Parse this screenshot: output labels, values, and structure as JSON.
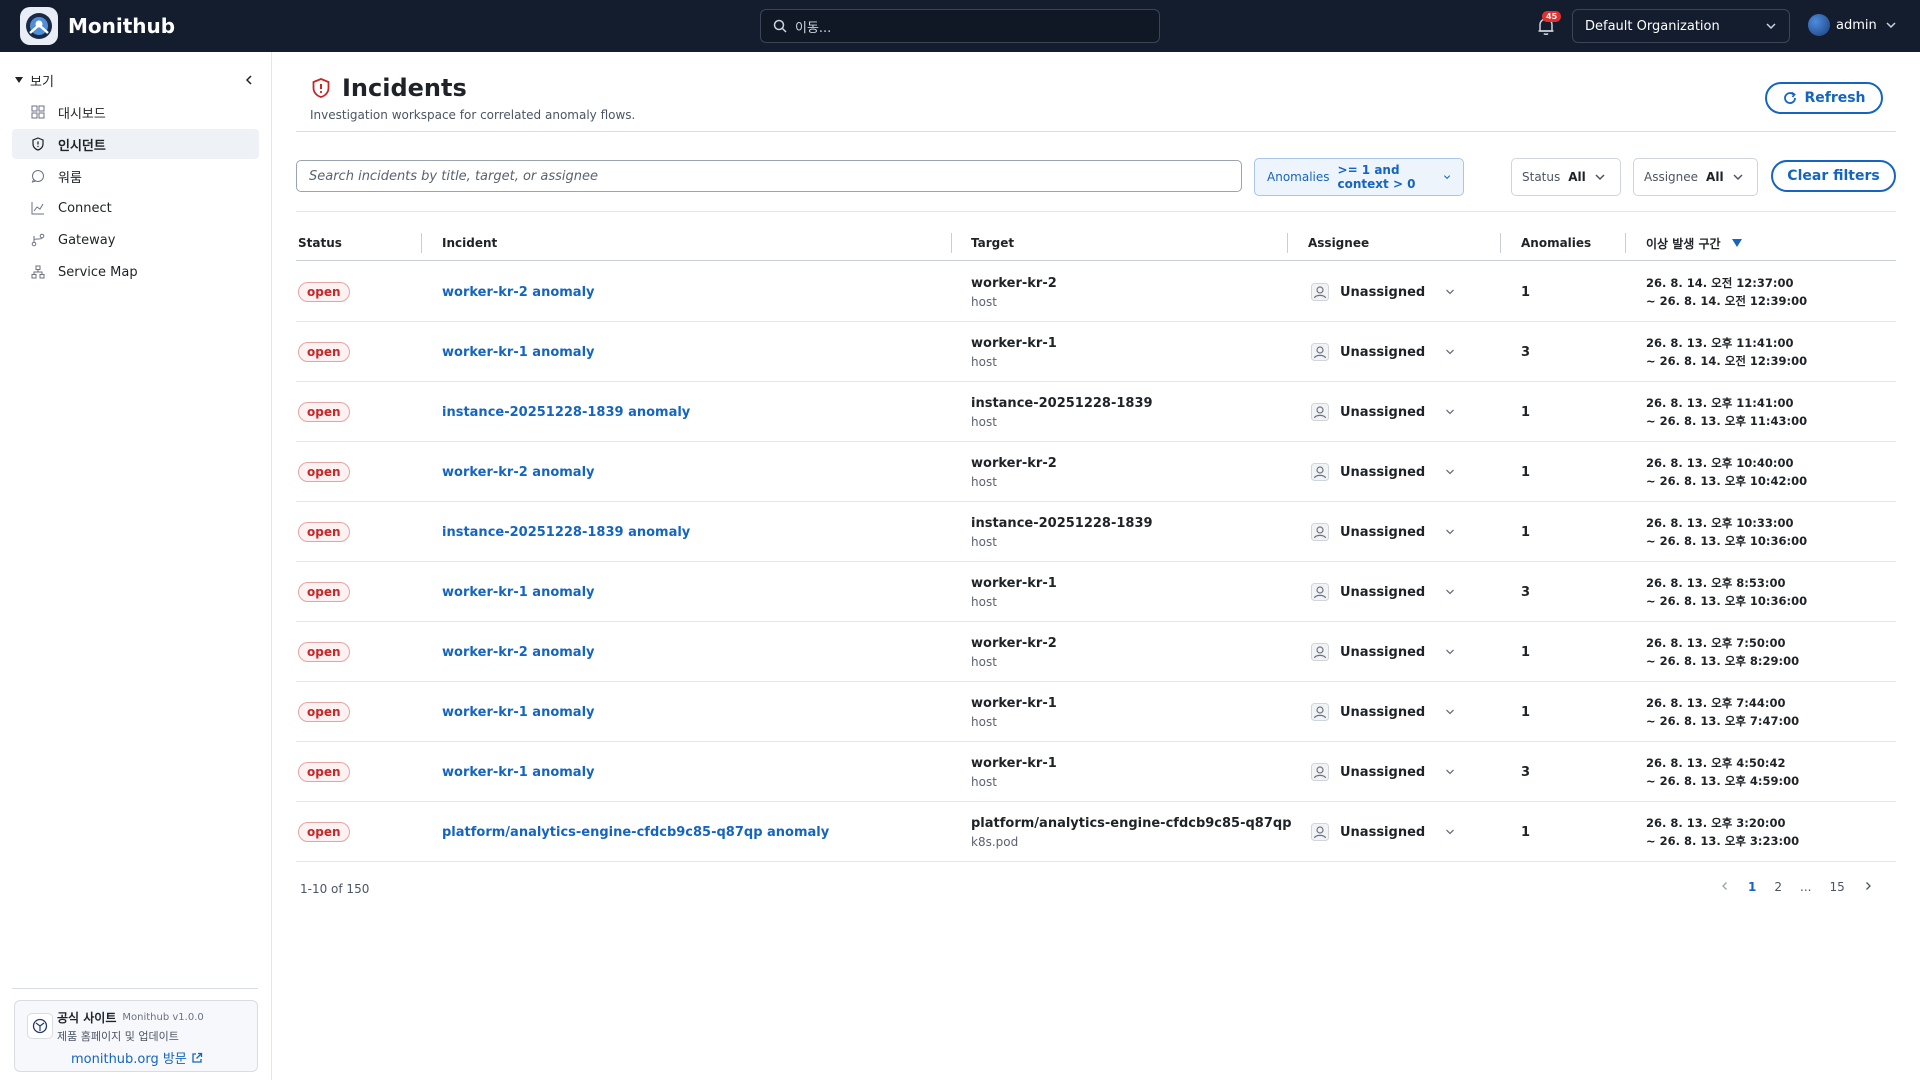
{
  "app": {
    "name": "Monithub",
    "brand_color": "#141d2e",
    "accent": "#1565c0"
  },
  "topbar": {
    "search_placeholder": "이동...",
    "notification_count": "45",
    "org": "Default Organization",
    "user": "admin"
  },
  "sidebar": {
    "section": "보기",
    "items": [
      {
        "label": "대시보드",
        "icon": "grid-icon",
        "active": false
      },
      {
        "label": "인시던트",
        "icon": "shield-alert-icon",
        "active": true
      },
      {
        "label": "워룸",
        "icon": "chat-bubble-icon",
        "active": false
      },
      {
        "label": "Connect",
        "icon": "connect-icon",
        "active": false
      },
      {
        "label": "Gateway",
        "icon": "branch-icon",
        "active": false
      },
      {
        "label": "Service Map",
        "icon": "network-icon",
        "active": false
      }
    ],
    "footer": {
      "title": "공식 사이트",
      "version": "Monithub v1.0.0",
      "desc": "제품 홈페이지 및 업데이트",
      "link": "monithub.org 방문"
    }
  },
  "page": {
    "title": "Incidents",
    "subtitle": "Investigation workspace for correlated anomaly flows.",
    "refresh": "Refresh"
  },
  "filters": {
    "search_placeholder": "Search incidents by title, target, or assignee",
    "anomalies_label": "Anomalies",
    "anomalies_value": ">= 1 and context > 0",
    "status_label": "Status",
    "status_value": "All",
    "assignee_label": "Assignee",
    "assignee_value": "All",
    "clear": "Clear filters"
  },
  "table": {
    "headers": {
      "status": "Status",
      "incident": "Incident",
      "target": "Target",
      "assignee": "Assignee",
      "anomalies": "Anomalies",
      "range": "이상 발생 구간"
    },
    "rows": [
      {
        "status": "open",
        "incident": "worker-kr-2 anomaly",
        "target": "worker-kr-2",
        "kind": "host",
        "assignee": "Unassigned",
        "anomalies": "1",
        "start": "26. 8. 14. 오전 12:37:00",
        "end": "~ 26. 8. 14. 오전 12:39:00"
      },
      {
        "status": "open",
        "incident": "worker-kr-1 anomaly",
        "target": "worker-kr-1",
        "kind": "host",
        "assignee": "Unassigned",
        "anomalies": "3",
        "start": "26. 8. 13. 오후 11:41:00",
        "end": "~ 26. 8. 14. 오전 12:39:00"
      },
      {
        "status": "open",
        "incident": "instance-20251228-1839 anomaly",
        "target": "instance-20251228-1839",
        "kind": "host",
        "assignee": "Unassigned",
        "anomalies": "1",
        "start": "26. 8. 13. 오후 11:41:00",
        "end": "~ 26. 8. 13. 오후 11:43:00"
      },
      {
        "status": "open",
        "incident": "worker-kr-2 anomaly",
        "target": "worker-kr-2",
        "kind": "host",
        "assignee": "Unassigned",
        "anomalies": "1",
        "start": "26. 8. 13. 오후 10:40:00",
        "end": "~ 26. 8. 13. 오후 10:42:00"
      },
      {
        "status": "open",
        "incident": "instance-20251228-1839 anomaly",
        "target": "instance-20251228-1839",
        "kind": "host",
        "assignee": "Unassigned",
        "anomalies": "1",
        "start": "26. 8. 13. 오후 10:33:00",
        "end": "~ 26. 8. 13. 오후 10:36:00"
      },
      {
        "status": "open",
        "incident": "worker-kr-1 anomaly",
        "target": "worker-kr-1",
        "kind": "host",
        "assignee": "Unassigned",
        "anomalies": "3",
        "start": "26. 8. 13. 오후 8:53:00",
        "end": "~ 26. 8. 13. 오후 10:36:00"
      },
      {
        "status": "open",
        "incident": "worker-kr-2 anomaly",
        "target": "worker-kr-2",
        "kind": "host",
        "assignee": "Unassigned",
        "anomalies": "1",
        "start": "26. 8. 13. 오후 7:50:00",
        "end": "~ 26. 8. 13. 오후 8:29:00"
      },
      {
        "status": "open",
        "incident": "worker-kr-1 anomaly",
        "target": "worker-kr-1",
        "kind": "host",
        "assignee": "Unassigned",
        "anomalies": "1",
        "start": "26. 8. 13. 오후 7:44:00",
        "end": "~ 26. 8. 13. 오후 7:47:00"
      },
      {
        "status": "open",
        "incident": "worker-kr-1 anomaly",
        "target": "worker-kr-1",
        "kind": "host",
        "assignee": "Unassigned",
        "anomalies": "3",
        "start": "26. 8. 13. 오후 4:50:42",
        "end": "~ 26. 8. 13. 오후 4:59:00"
      },
      {
        "status": "open",
        "incident": "platform/analytics-engine-cfdcb9c85-q87qp anomaly",
        "target": "platform/analytics-engine-cfdcb9c85-q87qp",
        "kind": "k8s.pod",
        "assignee": "Unassigned",
        "anomalies": "1",
        "start": "26. 8. 13. 오후 3:20:00",
        "end": "~ 26. 8. 13. 오후 3:23:00"
      }
    ]
  },
  "pagination": {
    "info": "1-10 of 150",
    "pages": [
      "1",
      "2",
      "...",
      "15"
    ],
    "current": "1"
  }
}
